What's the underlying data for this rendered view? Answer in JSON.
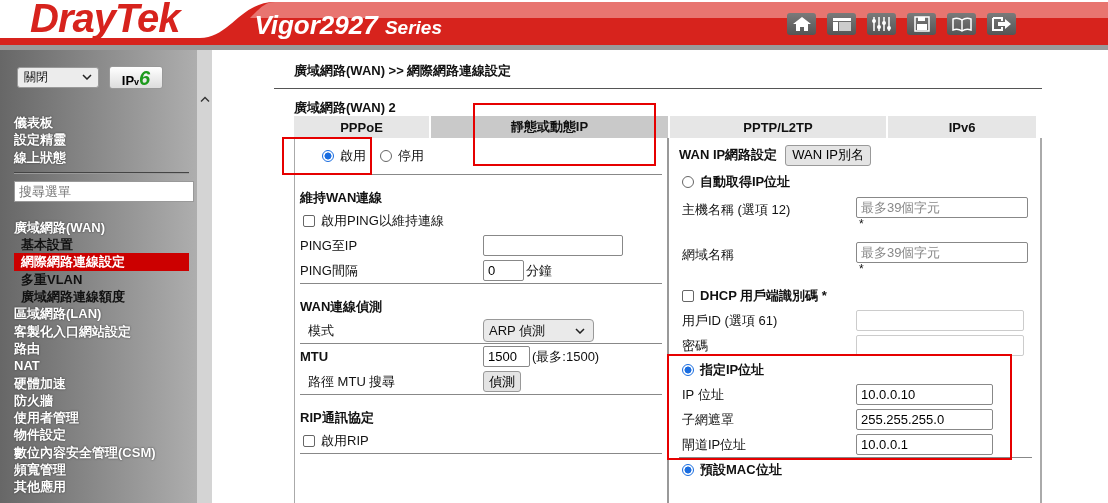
{
  "header": {
    "logo": "DrayTek",
    "model": "Vigor2927",
    "series": "Series"
  },
  "sidebar": {
    "mode_select": "關閉",
    "ipv6_button": {
      "prefix": "IP",
      "sub": "v",
      "suffix": "6"
    },
    "top_items": [
      {
        "label": "儀表板",
        "selected": false
      },
      {
        "label": "設定精靈",
        "selected": false
      },
      {
        "label": "線上狀態",
        "selected": false
      }
    ],
    "search": {
      "placeholder": "搜尋選單"
    },
    "menu": [
      {
        "label": "廣域網路(WAN)",
        "selected": false,
        "children": [
          {
            "label": "基本設置",
            "selected": false
          },
          {
            "label": "網際網路連線設定",
            "selected": true
          },
          {
            "label": "多重VLAN",
            "selected": false
          },
          {
            "label": "廣域網路連線額度",
            "selected": false
          }
        ]
      },
      {
        "label": "區域網路(LAN)",
        "selected": false
      },
      {
        "label": "客製化入口網站設定",
        "selected": false
      },
      {
        "label": "路由",
        "selected": false
      },
      {
        "label": "NAT",
        "selected": false
      },
      {
        "label": "硬體加速",
        "selected": false
      },
      {
        "label": "防火牆",
        "selected": false
      },
      {
        "label": "使用者管理",
        "selected": false
      },
      {
        "label": "物件設定",
        "selected": false
      },
      {
        "label": "數位內容安全管理(CSM)",
        "selected": false
      },
      {
        "label": "頻寬管理",
        "selected": false
      },
      {
        "label": "其他應用",
        "selected": false
      }
    ]
  },
  "breadcrumb": "廣域網路(WAN) >> 網際網路連線設定",
  "section_title": "廣域網路(WAN) 2",
  "tabs": [
    {
      "label": "PPPoE",
      "selected": false,
      "highlighted": false
    },
    {
      "label": "靜態或動態IP",
      "selected": true,
      "highlighted": true
    },
    {
      "label": "PPTP/L2TP",
      "selected": false,
      "highlighted": false
    },
    {
      "label": "IPv6",
      "selected": false,
      "highlighted": false
    }
  ],
  "left_panel": [
    {
      "highlighted": false,
      "rows": [
        {
          "kind": "radios",
          "options": [
            {
              "label": "啟用",
              "selected": true,
              "highlighted": true
            },
            {
              "label": "停用",
              "selected": false,
              "highlighted": false
            }
          ]
        }
      ]
    },
    {
      "highlighted": false,
      "rows": [
        {
          "kind": "heading",
          "label": "維持WAN連線"
        },
        {
          "kind": "checkbox",
          "label": "啟用PING以維持連線",
          "checked": false
        },
        {
          "kind": "input",
          "label": "PING至IP"
        },
        {
          "kind": "input",
          "label": "PING間隔",
          "value": "0",
          "unit": "分鐘"
        }
      ]
    },
    {
      "highlighted": false,
      "rows": [
        {
          "kind": "heading",
          "label": "WAN連線偵測"
        },
        {
          "kind": "select",
          "label": "模式",
          "value": "ARP 偵測"
        }
      ]
    },
    {
      "highlighted": false,
      "rows": [
        {
          "kind": "heading_input",
          "label": "MTU",
          "value": "1500",
          "unit": "(最多:1500)"
        },
        {
          "kind": "button",
          "label": "路徑 MTU 搜尋",
          "button": "偵測"
        }
      ]
    },
    {
      "highlighted": false,
      "rows": [
        {
          "kind": "heading",
          "label": "RIP通訊協定"
        },
        {
          "kind": "checkbox",
          "label": "啟用RIP",
          "checked": false
        }
      ]
    }
  ],
  "right_panel": [
    {
      "highlighted": false,
      "rows": [
        {
          "kind": "heading_button",
          "label": "WAN IP網路設定",
          "button": "WAN IP別名"
        },
        {
          "kind": "radio",
          "label": "自動取得IP位址",
          "selected": false
        },
        {
          "kind": "input",
          "label": "主機名稱 (選項 12)",
          "placeholder": "最多39個字元",
          "note": "*"
        },
        {
          "kind": "input",
          "label": "網域名稱",
          "placeholder": "最多39個字元",
          "note": "*"
        },
        {
          "kind": "checkbox",
          "label": "DHCP 用戶端識別碼 *",
          "checked": false
        },
        {
          "kind": "input",
          "label": "用戶ID (選項 61)"
        },
        {
          "kind": "input",
          "label": "密碼"
        }
      ]
    },
    {
      "highlighted": true,
      "rows": [
        {
          "kind": "radio",
          "label": "指定IP位址",
          "selected": true
        },
        {
          "kind": "input",
          "label": "IP 位址",
          "value": "10.0.0.10"
        },
        {
          "kind": "input",
          "label": "子網遮罩",
          "value": "255.255.255.0"
        },
        {
          "kind": "input",
          "label": "閘道IP位址",
          "value": "10.0.0.1"
        }
      ]
    },
    {
      "highlighted": false,
      "rows": [
        {
          "kind": "radio",
          "label": "預設MAC位址",
          "selected": true
        }
      ]
    }
  ]
}
